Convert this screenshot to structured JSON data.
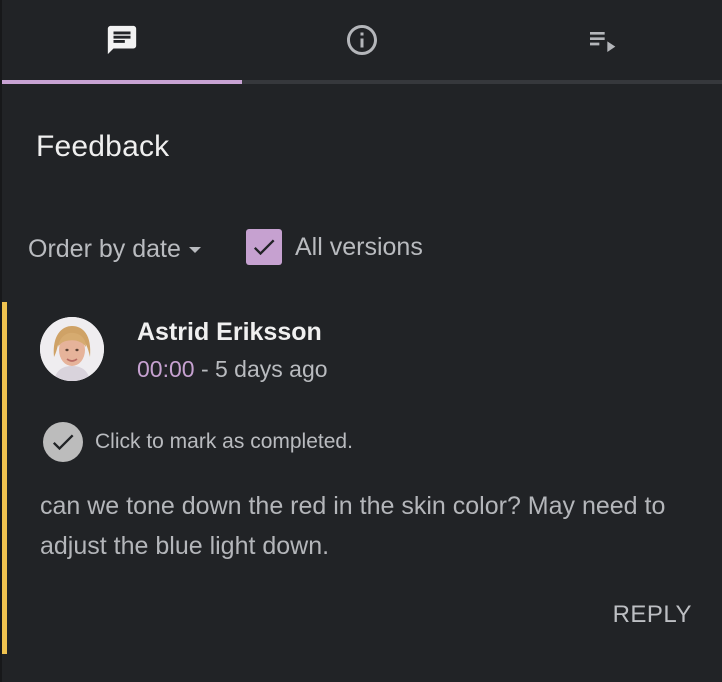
{
  "tabs": [
    {
      "icon": "comment-icon",
      "active": true
    },
    {
      "icon": "info-icon",
      "active": false
    },
    {
      "icon": "playlist-icon",
      "active": false
    }
  ],
  "panel": {
    "title": "Feedback",
    "order_label": "Order by date",
    "versions_label": "All versions",
    "versions_checked": true
  },
  "comment": {
    "author": "Astrid Eriksson",
    "timestamp": "00:00",
    "age": " - 5 days ago",
    "complete_label": "Click to mark as completed.",
    "text": "can we tone down the red in the skin color? May need to adjust the blue light down.",
    "reply_label": "REPLY"
  },
  "colors": {
    "background": "#212326",
    "accent": "#c6a1d0",
    "comment_marker": "#efc24f",
    "tab_indicator": "#c8a3d3"
  }
}
